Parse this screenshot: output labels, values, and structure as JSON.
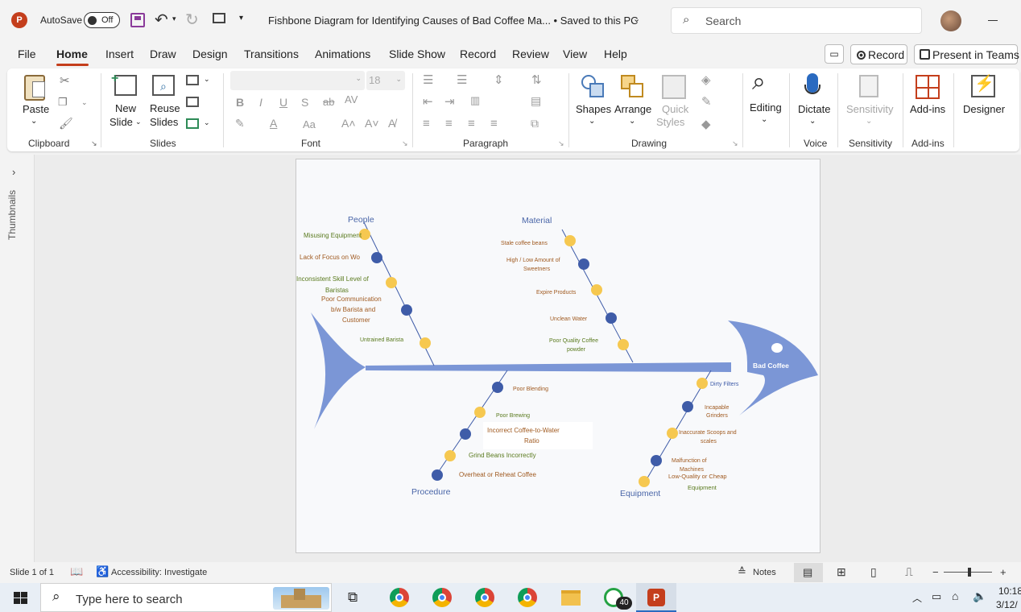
{
  "titlebar": {
    "autosave_label": "AutoSave",
    "toggle_label": "Off",
    "doc_title": "Fishbone Diagram for Identifying Causes of Bad Coffee Ma... • Saved to this PC",
    "search_placeholder": "Search"
  },
  "tabs": [
    "File",
    "Home",
    "Insert",
    "Draw",
    "Design",
    "Transitions",
    "Animations",
    "Slide Show",
    "Record",
    "Review",
    "View",
    "Help"
  ],
  "actions": {
    "record": "Record",
    "present": "Present in Teams"
  },
  "ribbon": {
    "paste": "Paste",
    "new_slide": [
      "New",
      "Slide"
    ],
    "reuse_slides": [
      "Reuse",
      "Slides"
    ],
    "font_size": "18",
    "shapes": "Shapes",
    "arrange": "Arrange",
    "quick_styles": [
      "Quick",
      "Styles"
    ],
    "editing": "Editing",
    "dictate": "Dictate",
    "sensitivity": "Sensitivity",
    "addins": "Add-ins",
    "designer": "Designer",
    "groups": [
      "Clipboard",
      "Slides",
      "Font",
      "Paragraph",
      "Drawing",
      "Voice",
      "Sensitivity",
      "Add-ins"
    ]
  },
  "thumbnails_label": "Thumbnails",
  "diagram": {
    "head_label": "Bad Coffee",
    "categories": {
      "people": "People",
      "material": "Material",
      "procedure": "Procedure",
      "equipment": "Equipment"
    },
    "people_causes": [
      "Misusing Equipment",
      "Lack of Focus on Wo",
      "Inconsistent Skill Level of",
      "Baristas",
      "Poor Communication",
      "b/w Barista and",
      "Customer",
      "Untrained Barista"
    ],
    "material_causes": [
      "Stale coffee beans",
      "High / Low Amount of",
      "Sweetners",
      "Expire Products",
      "Unclean Water",
      "Poor Quality Coffee",
      "powder"
    ],
    "procedure_causes": [
      "Poor Blending",
      "Poor Brewing",
      "Incorrect Coffee-to-Water",
      "Ratio",
      "Grind Beans Incorrectly",
      "Overheat or Reheat Coffee"
    ],
    "equipment_causes": [
      "Dirty Filters",
      "Incapable",
      "Grinders",
      "Inaccurate Scoops and",
      "scales",
      "Malfunction of",
      "Machines",
      "Low-Quality or Cheap",
      "Equipment"
    ],
    "colors": {
      "fish": "#7b96d6",
      "dot_yellow": "#f6c850",
      "dot_blue": "#3f5ca8",
      "label_blue": "#4a66a8",
      "text_green": "#5a7a1e",
      "text_brown": "#a05a20"
    }
  },
  "status": {
    "slide": "Slide 1 of 1",
    "accessibility": "Accessibility: Investigate",
    "notes": "Notes"
  },
  "taskbar": {
    "search_placeholder": "Type here to search",
    "badge": "40",
    "time": "10:18",
    "date": "3/12/"
  }
}
